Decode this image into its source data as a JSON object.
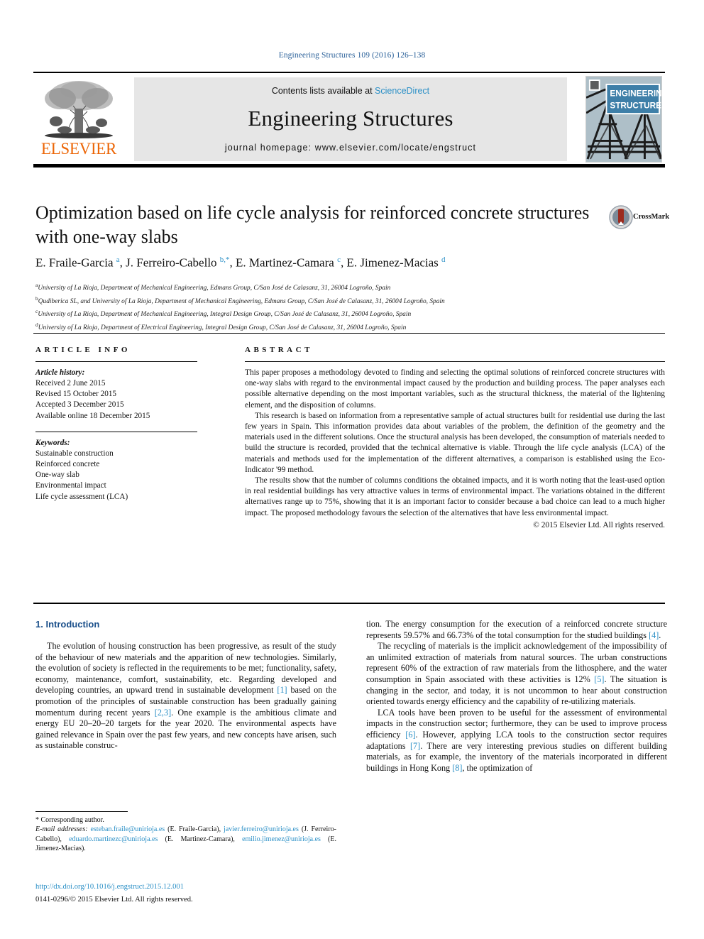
{
  "running_head": "Engineering Structures 109 (2016) 126–138",
  "masthead": {
    "contents_prefix": "Contents lists available at",
    "sciencedirect": "ScienceDirect",
    "journal_title": "Engineering Structures",
    "homepage": "journal homepage: www.elsevier.com/locate/engstruct",
    "publisher": "ELSEVIER",
    "cover_line1": "ENGINEERING",
    "cover_line2": "STRUCTURES",
    "accent_link": "#2a8fc6",
    "publisher_color": "#ec6607"
  },
  "article": {
    "title": "Optimization based on life cycle analysis for reinforced concrete structures with one-way slabs",
    "authors_html": "E. Fraile-Garcia <sup>a</sup>, J. Ferreiro-Cabello <sup>b,*</sup>, E. Martinez-Camara <sup>c</sup>, E. Jimenez-Macias <sup>d</sup>",
    "crossmark_label": "CrossMark",
    "affiliations": [
      "a University of La Rioja, Department of Mechanical Engineering, Edmans Group, C/San José de Calasanz, 31, 26004 Logroño, Spain",
      "b Qudiberica SL, and University of La Rioja, Department of Mechanical Engineering, Edmans Group, C/San José de Calasanz, 31, 26004 Logroño, Spain",
      "c University of La Rioja, Department of Mechanical Engineering, Integral Design Group, C/San José de Calasanz, 31, 26004 Logroño, Spain",
      "d University of La Rioja, Department of Electrical Engineering, Integral Design Group, C/San José de Calasanz, 31, 26004 Logroño, Spain"
    ]
  },
  "article_info": {
    "heading": "ARTICLE INFO",
    "history_label": "Article history:",
    "history": [
      "Received 2 June 2015",
      "Revised 15 October 2015",
      "Accepted 3 December 2015",
      "Available online 18 December 2015"
    ],
    "keywords_label": "Keywords:",
    "keywords": [
      "Sustainable construction",
      "Reinforced concrete",
      "One-way slab",
      "Environmental impact",
      "Life cycle assessment (LCA)"
    ]
  },
  "abstract": {
    "heading": "ABSTRACT",
    "paragraphs": [
      "This paper proposes a methodology devoted to finding and selecting the optimal solutions of reinforced concrete structures with one-way slabs with regard to the environmental impact caused by the production and building process. The paper analyses each possible alternative depending on the most important variables, such as the structural thickness, the material of the lightening element, and the disposition of columns.",
      "This research is based on information from a representative sample of actual structures built for residential use during the last few years in Spain. This information provides data about variables of the problem, the definition of the geometry and the materials used in the different solutions. Once the structural analysis has been developed, the consumption of materials needed to build the structure is recorded, provided that the technical alternative is viable. Through the life cycle analysis (LCA) of the materials and methods used for the implementation of the different alternatives, a comparison is established using the Eco-Indicator '99 method.",
      "The results show that the number of columns conditions the obtained impacts, and it is worth noting that the least-used option in real residential buildings has very attractive values in terms of environmental impact. The variations obtained in the different alternatives range up to 75%, showing that it is an important factor to consider because a bad choice can lead to a much higher impact. The proposed methodology favours the selection of the alternatives that have less environmental impact."
    ],
    "copyright": "© 2015 Elsevier Ltd. All rights reserved."
  },
  "body": {
    "section_heading": "1. Introduction",
    "left_paragraph_1_html": "The evolution of housing construction has been progressive, as result of the study of the behaviour of new materials and the apparition of new technologies. Similarly, the evolution of society is reflected in the requirements to be met; functionality, safety, economy, maintenance, comfort, sustainability, etc. Regarding developed and developing countries, an upward trend in sustainable development <span class=\"ref\">[1]</span> based on the promotion of the principles of sustainable construction has been gradually gaining momentum during recent years <span class=\"ref\">[2,3]</span>. One example is the ambitious climate and energy EU 20–20–20 targets for the year 2020. The environmental aspects have gained relevance in Spain over the past few years, and new concepts have arisen, such as sustainable construc-",
    "right_paragraph_1_html": "tion. The energy consumption for the execution of a reinforced concrete structure represents 59.57% and 66.73% of the total consumption for the studied buildings <span class=\"ref\">[4]</span>.",
    "right_paragraph_2_html": "The recycling of materials is the implicit acknowledgement of the impossibility of an unlimited extraction of materials from natural sources. The urban constructions represent 60% of the extraction of raw materials from the lithosphere, and the water consumption in Spain associated with these activities is 12% <span class=\"ref\">[5]</span>. The situation is changing in the sector, and today, it is not uncommon to hear about construction oriented towards energy efficiency and the capability of re-utilizing materials.",
    "right_paragraph_3_html": "LCA tools have been proven to be useful for the assessment of environmental impacts in the construction sector; furthermore, they can be used to improve process efficiency <span class=\"ref\">[6]</span>. However, applying LCA tools to the construction sector requires adaptations <span class=\"ref\">[7]</span>. There are very interesting previous studies on different building materials, as for example, the inventory of the materials incorporated in different buildings in Hong Kong <span class=\"ref\">[8]</span>, the optimization of"
  },
  "footnote": {
    "corresponding_marker": "*",
    "corresponding_text": "Corresponding author.",
    "email_label": "E-mail addresses:",
    "emails_html": "<span class=\"mail\">esteban.fraile@unirioja.es</span> (E. Fraile-Garcia), <span class=\"mail\">javier.ferreiro@unirioja.es</span> (J. Ferreiro-Cabello), <span class=\"mail\">eduardo.martinezc@unirioja.es</span> (E. Martinez-Camara), <span class=\"mail\">emilio.jimenez@unirioja.es</span> (E. Jimenez-Macias).",
    "doi": "http://dx.doi.org/10.1016/j.engstruct.2015.12.001",
    "issn_line": "0141-0296/© 2015 Elsevier Ltd. All rights reserved."
  }
}
